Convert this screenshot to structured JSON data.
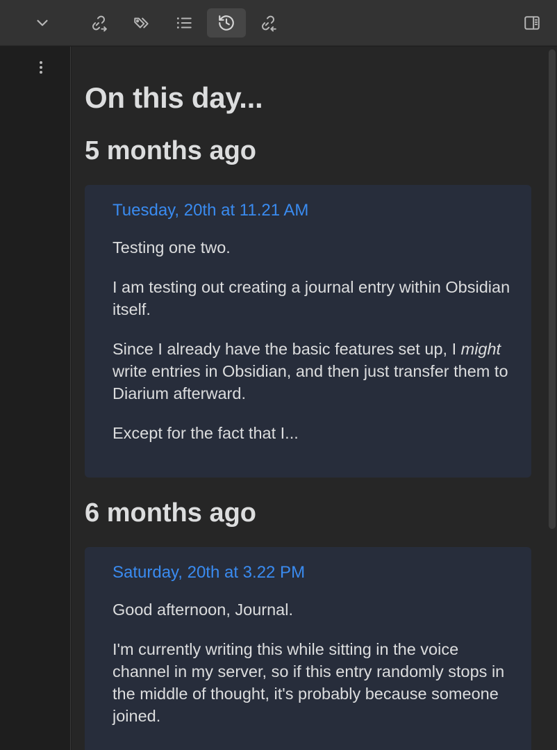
{
  "toolbar": {
    "buttons": [
      {
        "name": "collapse-chevron",
        "icon": "chevron-down-icon"
      },
      {
        "name": "outgoing-links",
        "icon": "link-arrow-out-icon"
      },
      {
        "name": "tags",
        "icon": "tags-icon"
      },
      {
        "name": "outline",
        "icon": "list-icon"
      },
      {
        "name": "on-this-day",
        "icon": "history-icon",
        "active": true
      },
      {
        "name": "backlinks",
        "icon": "link-arrow-in-icon"
      },
      {
        "name": "toggle-right-sidebar",
        "icon": "sidebar-right-icon"
      }
    ]
  },
  "main": {
    "title": "On this day...",
    "sections": [
      {
        "heading": "5 months ago",
        "entry": {
          "date": "Tuesday, 20th at 11.21 AM",
          "paragraphs": [
            "Testing one two.",
            "I am testing out creating a journal entry within Obsidian itself.",
            "write entries in Obsidian, and then just transfer them to Diarium afterward.",
            "Except for the fact that I..."
          ],
          "para3_lead": "Since I already have the basic features set up, I ",
          "para3_em": "might"
        }
      },
      {
        "heading": "6 months ago",
        "entry": {
          "date": "Saturday, 20th at 3.22 PM",
          "paragraphs": [
            "Good afternoon, Journal.",
            "I'm currently writing this while sitting in the voice channel in my server, so if this entry randomly stops in the middle of thought, it's probably because someone joined."
          ]
        }
      }
    ]
  },
  "colors": {
    "toolbar_bg": "#333333",
    "content_bg": "#262626",
    "card_bg": "#272d3b",
    "date_link": "#3a8bf0",
    "text": "#dcddde"
  }
}
